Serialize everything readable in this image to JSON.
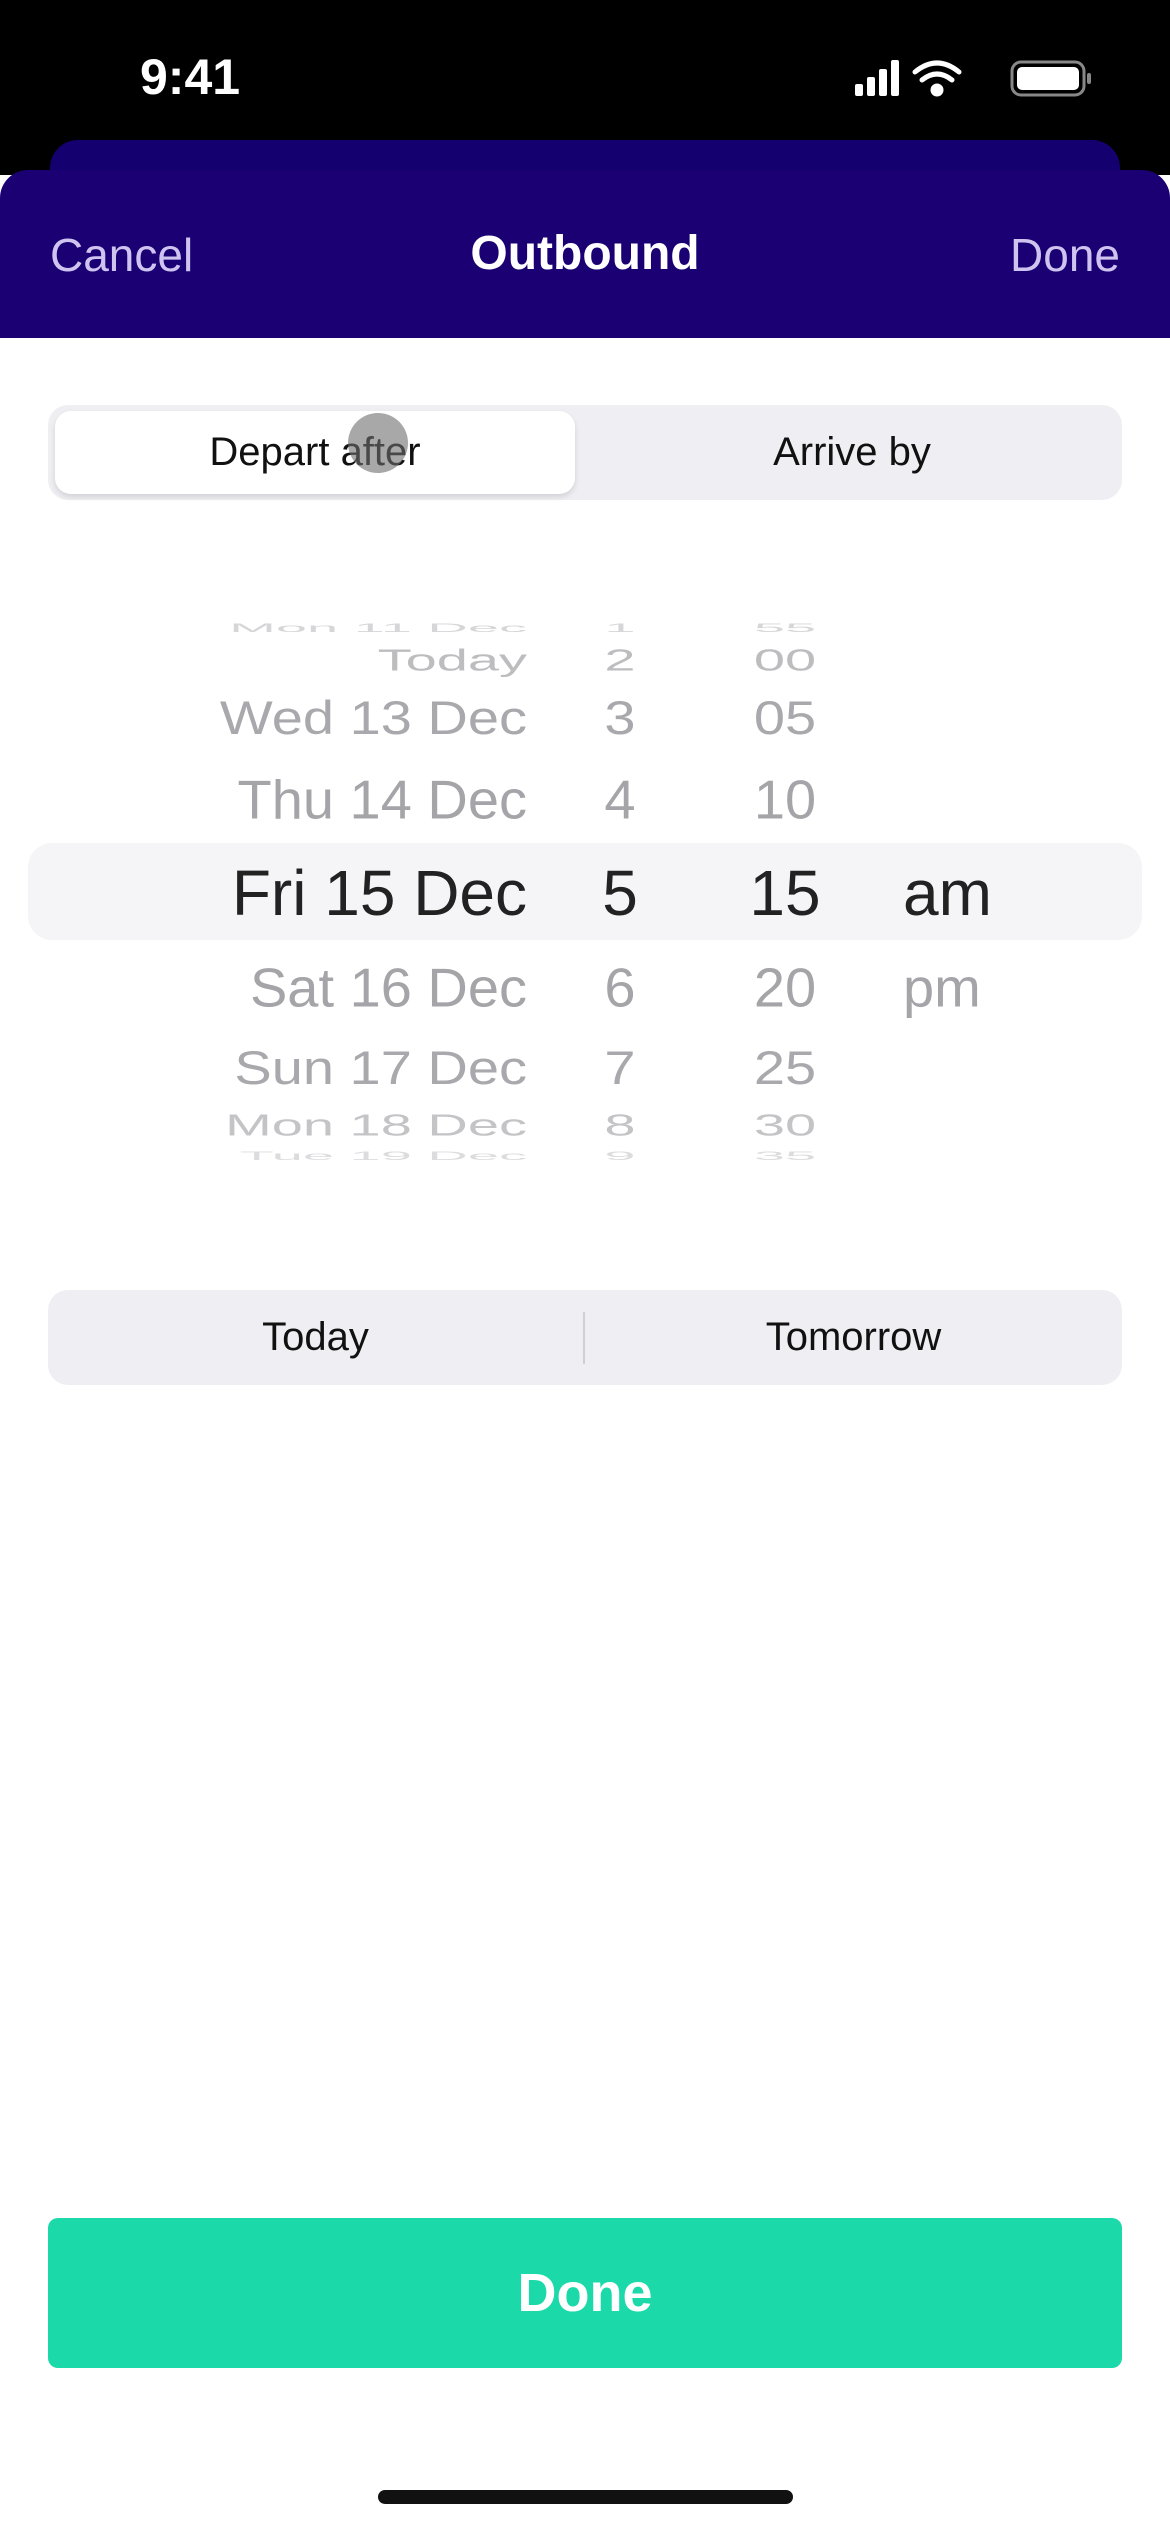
{
  "status_bar": {
    "time": "9:41",
    "icons": [
      "signal-icon",
      "wifi-icon",
      "battery-icon"
    ]
  },
  "header": {
    "cancel": "Cancel",
    "title": "Outbound",
    "done": "Done",
    "color": "#1a0073"
  },
  "mode_toggle": {
    "options": [
      "Depart after",
      "Arrive by"
    ],
    "selected": "Depart after"
  },
  "picker": {
    "dates": [
      "Mon 11 Dec",
      "Today",
      "Wed 13 Dec",
      "Thu 14 Dec",
      "Fri 15 Dec",
      "Sat 16 Dec",
      "Sun 17 Dec",
      "Mon 18 Dec",
      "Tue 19 Dec"
    ],
    "hours": [
      "1",
      "2",
      "3",
      "4",
      "5",
      "6",
      "7",
      "8",
      "9"
    ],
    "minutes": [
      "55",
      "00",
      "05",
      "10",
      "15",
      "20",
      "25",
      "30",
      "35"
    ],
    "ampm": [
      "am",
      "pm"
    ],
    "selected": {
      "date": "Fri 15 Dec",
      "hour": "5",
      "minute": "15",
      "ampm": "am"
    }
  },
  "quick_days": {
    "options": [
      "Today",
      "Tomorrow"
    ]
  },
  "done_button": {
    "label": "Done",
    "color": "#1bd9a8"
  }
}
